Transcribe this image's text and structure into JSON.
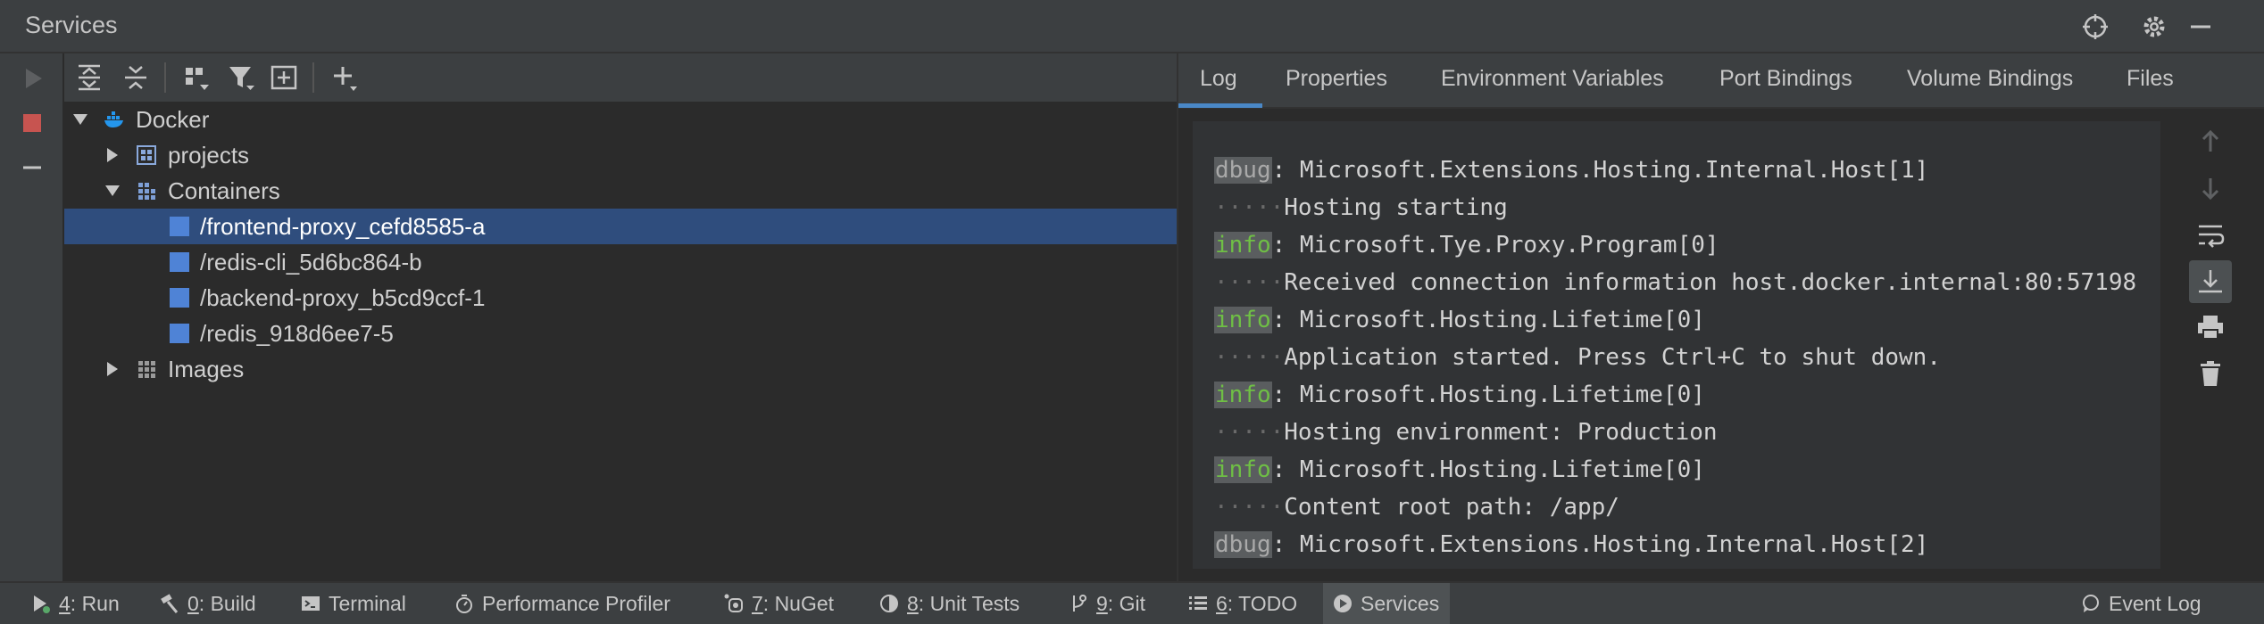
{
  "window": {
    "title": "Services"
  },
  "tree": {
    "root": "Docker",
    "items": [
      {
        "label": "projects"
      },
      {
        "label": "Containers"
      },
      {
        "label": "/frontend-proxy_cefd8585-a"
      },
      {
        "label": "/redis-cli_5d6bc864-b"
      },
      {
        "label": "/backend-proxy_b5cd9ccf-1"
      },
      {
        "label": "/redis_918d6ee7-5"
      },
      {
        "label": "Images"
      }
    ]
  },
  "tabs": [
    {
      "label": "Log"
    },
    {
      "label": "Properties"
    },
    {
      "label": "Environment Variables"
    },
    {
      "label": "Port Bindings"
    },
    {
      "label": "Volume Bindings"
    },
    {
      "label": "Files"
    }
  ],
  "log": {
    "lines": [
      {
        "level": "dbug",
        "text": ": Microsoft.Extensions.Hosting.Internal.Host[1]"
      },
      {
        "dots": "·····",
        "text": "Hosting starting"
      },
      {
        "level": "info",
        "text": ": Microsoft.Tye.Proxy.Program[0]"
      },
      {
        "dots": "·····",
        "text": "Received connection information host.docker.internal:80:57198"
      },
      {
        "level": "info",
        "text": ": Microsoft.Hosting.Lifetime[0]"
      },
      {
        "dots": "·····",
        "text": "Application started. Press Ctrl+C to shut down."
      },
      {
        "level": "info",
        "text": ": Microsoft.Hosting.Lifetime[0]"
      },
      {
        "dots": "·····",
        "text": "Hosting environment: Production"
      },
      {
        "level": "info",
        "text": ": Microsoft.Hosting.Lifetime[0]"
      },
      {
        "dots": "·····",
        "text": "Content root path: /app/"
      },
      {
        "level": "dbug",
        "text": ": Microsoft.Extensions.Hosting.Internal.Host[2]"
      }
    ]
  },
  "bottombar": {
    "run": {
      "key": "4",
      "label": ": Run"
    },
    "build": {
      "key": "0",
      "label": ": Build"
    },
    "terminal": {
      "label": "Terminal"
    },
    "profiler": {
      "label": "Performance Profiler"
    },
    "nuget": {
      "key": "7",
      "label": ": NuGet"
    },
    "unittests": {
      "key": "8",
      "label": ": Unit Tests"
    },
    "git": {
      "key": "9",
      "label": ": Git"
    },
    "todo": {
      "key": "6",
      "label": ": TODO"
    },
    "services": {
      "label": "Services"
    },
    "eventlog": {
      "label": "Event Log"
    }
  },
  "colors": {
    "selection": "#2f4d7d",
    "accent": "#4a88c7",
    "info": "#6fbf45",
    "stop": "#c75450"
  }
}
